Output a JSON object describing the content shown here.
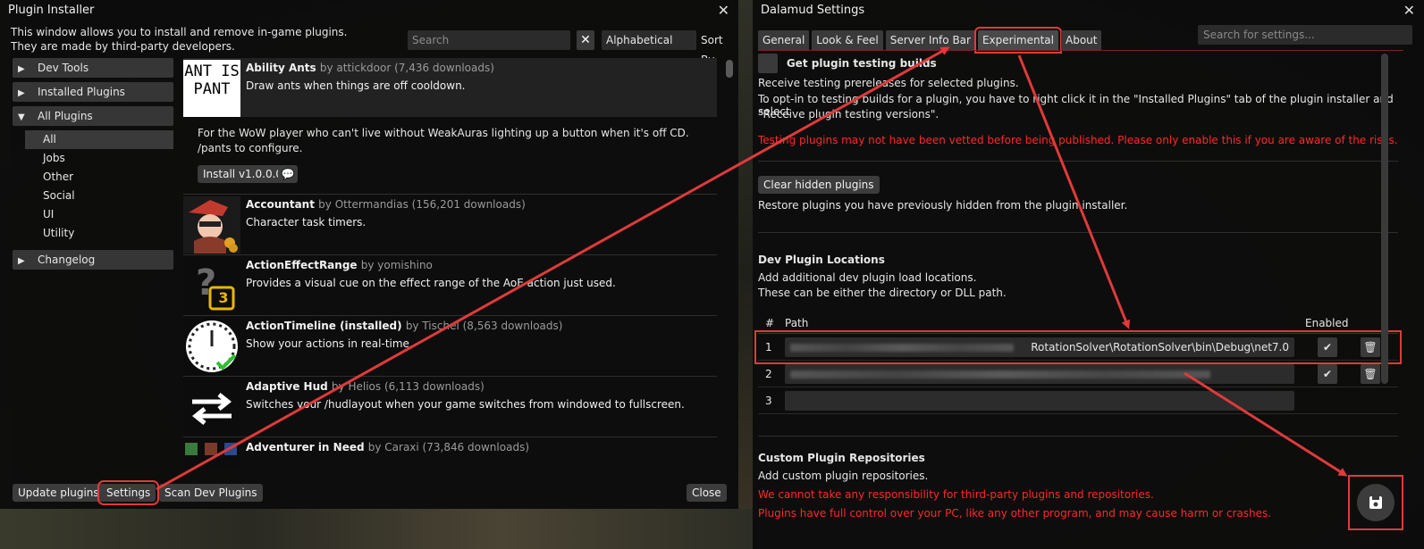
{
  "installer": {
    "title": "Plugin Installer",
    "intro_line1": "This window allows you to install and remove in-game plugins.",
    "intro_line2": "They are made by third-party developers.",
    "search_placeholder": "Search",
    "sort_value": "Alphabetical",
    "sort_label": "Sort By",
    "categories": [
      {
        "label": "Dev Tools",
        "expanded": false
      },
      {
        "label": "Installed Plugins",
        "expanded": false
      },
      {
        "label": "All Plugins",
        "expanded": true
      },
      {
        "label": "Changelog",
        "expanded": false
      }
    ],
    "subcategories": [
      "All",
      "Jobs",
      "Other",
      "Social",
      "UI",
      "Utility"
    ],
    "plugins": [
      {
        "name": "Ability Ants",
        "by": "by attickdoor (7,436 downloads)",
        "desc": "Draw ants when things are off cooldown.",
        "long_desc": "For the WoW player who can't live without WeakAuras lighting up a button when it's off CD. /pants to configure.",
        "install_label": "Install v1.0.0.0",
        "icon_text": "ANT IS PANT"
      },
      {
        "name": "Accountant",
        "by": "by Ottermandias (156,201 downloads)",
        "desc": "Character task timers."
      },
      {
        "name": "ActionEffectRange",
        "by": "by yomishino",
        "desc": "Provides a visual cue on the effect range of the AoE action just used.",
        "icon_text": "3"
      },
      {
        "name": "ActionTimeline (installed)",
        "by": "by Tischel (8,563 downloads)",
        "desc": "Show your actions in real-time."
      },
      {
        "name": "Adaptive Hud",
        "by": "by Helios (6,113 downloads)",
        "desc": "Switches your /hudlayout when your game switches from windowed to fullscreen."
      },
      {
        "name": "Adventurer in Need",
        "by": "by Caraxi (73,846 downloads)",
        "desc": ""
      }
    ],
    "footer": {
      "update_label": "Update plugins",
      "settings_label": "Settings",
      "scan_label": "Scan Dev Plugins",
      "close_label": "Close"
    }
  },
  "settings": {
    "title": "Dalamud Settings",
    "tabs": [
      "General",
      "Look & Feel",
      "Server Info Bar",
      "Experimental",
      "About"
    ],
    "active_tab": "Experimental",
    "search_placeholder": "Search for settings...",
    "testing_label": "Get plugin testing builds",
    "testing_desc1": "Receive testing prereleases for selected plugins.",
    "testing_desc2": "To opt-in to testing builds for a plugin, you have to right click it in the \"Installed Plugins\" tab of the plugin installer and select",
    "testing_desc3": "\"Receive plugin testing versions\".",
    "testing_warning": "Testing plugins may not have been vetted before being published. Please only enable this if you are aware of the risks.",
    "clear_hidden_label": "Clear hidden plugins",
    "clear_hidden_desc": "Restore plugins you have previously hidden from the plugin installer.",
    "dev_locations_title": "Dev Plugin Locations",
    "dev_locations_desc1": "Add additional dev plugin load locations.",
    "dev_locations_desc2": "These can be either the directory or DLL path.",
    "table_headers": {
      "num": "#",
      "path": "Path",
      "enabled": "Enabled"
    },
    "dev_rows": [
      {
        "num": "1",
        "path": "RotationSolver\\RotationSolver\\bin\\Debug\\net7.0"
      },
      {
        "num": "2",
        "path": ""
      },
      {
        "num": "3",
        "path": ""
      }
    ],
    "custom_repos_title": "Custom Plugin Repositories",
    "custom_repos_desc": "Add custom plugin repositories.",
    "custom_warn1": "We cannot take any responsibility for third-party plugins and repositories.",
    "custom_warn2": "Plugins have full control over your PC, like any other program, and may cause harm or crashes."
  },
  "colors": {
    "annotation": "#e03a3a",
    "warning": "#ff2828",
    "panel": "#0c0c0c"
  }
}
